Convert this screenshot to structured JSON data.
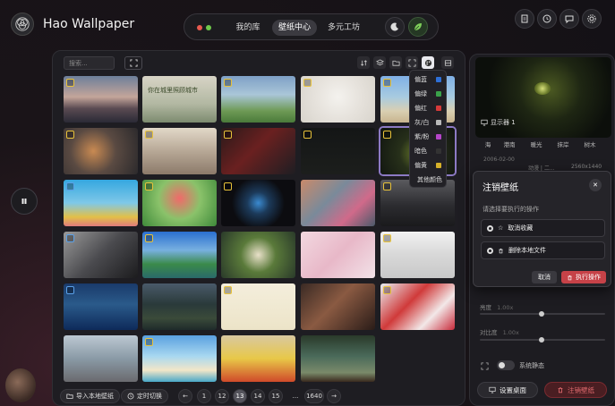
{
  "app": {
    "title": "Hao Wallpaper"
  },
  "nav": {
    "tabs": [
      {
        "label": "我的库",
        "active": false
      },
      {
        "label": "壁纸中心",
        "active": true
      },
      {
        "label": "多元工坊",
        "active": false
      }
    ],
    "dot_colors": [
      "#e85a4f",
      "#6fc94b"
    ]
  },
  "header_icons": [
    "moon-icon",
    "leaf-icon",
    "document-icon",
    "history-icon",
    "chat-icon",
    "settings-icon"
  ],
  "toolbar": {
    "search_placeholder": "搜索..."
  },
  "color_filter": {
    "items": [
      {
        "label": "偏蓝",
        "color": "#2e6fd6"
      },
      {
        "label": "偏绿",
        "color": "#3aa24a"
      },
      {
        "label": "偏红",
        "color": "#d63a3a"
      },
      {
        "label": "灰/白",
        "color": "#b9b9b9"
      },
      {
        "label": "紫/粉",
        "color": "#b545c9"
      },
      {
        "label": "暗色",
        "color": "#333333"
      },
      {
        "label": "偏黄",
        "color": "#d6b12a"
      },
      {
        "label": "其他颜色",
        "color": ""
      }
    ]
  },
  "grid": {
    "thumbs": [
      {
        "bg": "linear-gradient(180deg,#6d7f9a 0%,#c4a59a 45%,#5a4a52 70%,#2a2a36 100%)",
        "badge": "gold"
      },
      {
        "bg": "linear-gradient(180deg,#d8d4c6 0%,#b2b8a2 60%,#7d8b6f 100%)",
        "badge": "none"
      },
      {
        "bg": "linear-gradient(180deg,#7ea0c6 0%,#aac6d8 40%,#6e9a55 75%,#4a7a3a 100%)",
        "badge": "gold"
      },
      {
        "bg": "radial-gradient(circle at 50% 45%,#f4f2ee 0%,#e6e2dc 50%,#d8d4cc 100%)",
        "badge": "gold"
      },
      {
        "bg": "linear-gradient(180deg,#7fb0e6 0%,#a8cbe0 45%,#d9cfb2 75%,#c8b48e 100%)",
        "badge": "gold"
      },
      {
        "bg": "radial-gradient(circle at 40% 50%,#c98a52 0%,#5a4a42 45%,#2c2a2c 100%)",
        "badge": "gold"
      },
      {
        "bg": "linear-gradient(180deg,#e2d8c8 0%,#b7a896 50%,#8c7a6a 100%)",
        "badge": "gold"
      },
      {
        "bg": "linear-gradient(135deg,#2a1a1a 0%,#6a2020 45%,#1e1e22 100%)",
        "badge": "gold"
      },
      {
        "bg": "linear-gradient(180deg,#141616 0%,#1c1e1c 100%)",
        "badge": "gold"
      },
      {
        "bg": "radial-gradient(circle at 50% 55%,#6b7d2a 0%,#27301a 40%,#101410 100%)",
        "badge": "gold",
        "selected": true
      },
      {
        "bg": "linear-gradient(180deg,#35a7e0 0%,#7fc8e8 50%,#e2c048 80%,#e07b7b 100%)",
        "badge": "blue"
      },
      {
        "bg": "radial-gradient(circle at 50% 40%,#f06a6a 0%,#8ac26a 45%,#3f8a3a 100%)",
        "badge": "gold"
      },
      {
        "bg": "radial-gradient(circle at 50% 50%,#3a8ad0 0%,#1c3a5a 25%,#0c0c10 60%)",
        "badge": "gold"
      },
      {
        "bg": "linear-gradient(135deg,#c98a6a 0%,#7a8a9a 40%,#d06a8a 70%,#4a5a6a 100%)",
        "badge": "none"
      },
      {
        "bg": "linear-gradient(180deg,#5a5a5e 0%,#2c2c30 55%,#1a1a1c 100%)",
        "badge": "gold"
      },
      {
        "bg": "linear-gradient(135deg,#9a9a9a 0%,#4a4a4e 50%,#1c1c1e 100%)",
        "badge": "blue"
      },
      {
        "bg": "linear-gradient(180deg,#2a6fd0 0%,#78b0e0 40%,#3a8a4a 70%,#2a6a6a 100%)",
        "badge": "gold"
      },
      {
        "bg": "radial-gradient(circle at 50% 50%,#e8e0c8 0%,#5a7a3a 40%,#2a3a2a 100%)",
        "badge": "none"
      },
      {
        "bg": "linear-gradient(135deg,#f2d8e0 0%,#e8b8c8 50%,#f2e2e8 100%)",
        "badge": "none"
      },
      {
        "bg": "linear-gradient(180deg,#f2f2f2 0%,#d8d8d8 50%,#c8c8c8 100%)",
        "badge": "gold"
      },
      {
        "bg": "linear-gradient(180deg,#1a3a6a 0%,#2a5a8a 45%,#0e2a5a 100%)",
        "badge": "blue"
      },
      {
        "bg": "linear-gradient(180deg,#4a5a6a 0%,#2a3a3a 45%,#3a4a3a 75%,#1e2a2a 100%)",
        "badge": "none"
      },
      {
        "bg": "linear-gradient(180deg,#f4eedc 0%,#ece4c8 100%)",
        "badge": "gold"
      },
      {
        "bg": "linear-gradient(135deg,#3a2a24 0%,#8a5a42 45%,#2a1c18 100%)",
        "badge": "none"
      },
      {
        "bg": "linear-gradient(135deg,#e8eef2 0%,#d03a3a 40%,#f2e8e8 70%,#c82a3a 100%)",
        "badge": "gold"
      },
      {
        "bg": "linear-gradient(180deg,#bcc8d2 0%,#8a9aa6 50%,#6a6a6e 100%)",
        "badge": "none"
      },
      {
        "bg": "linear-gradient(180deg,#5aa0e0 0%,#a8d8f0 45%,#f2e6c8 75%,#48a8c8 100%)",
        "badge": "gold"
      },
      {
        "bg": "linear-gradient(180deg,#d8c8a0 0%,#e8c848 50%,#d04a2a 100%)",
        "badge": "none"
      },
      {
        "bg": "linear-gradient(180deg,#2a3a2a 0%,#4a6a5a 45%,#7a8a6a 80%,#3a2a1e 100%)",
        "badge": "none"
      }
    ],
    "overlay_texts": [
      "你在城里照顾城市"
    ]
  },
  "footer": {
    "import_label": "导入本地壁纸",
    "timer_label": "定时切换",
    "pages": [
      "1",
      "12",
      "13",
      "14",
      "15",
      "...",
      "1640"
    ],
    "current_page": "13"
  },
  "right_panel": {
    "monitor_label": "显示器 1",
    "tags": [
      "海",
      "港南",
      "暖光",
      "抹岸",
      "树木"
    ],
    "meta_date": "2006-02-00",
    "meta_mode": "动漫 | 二...",
    "meta_res": "2560x1440",
    "brightness_label": "亮度",
    "brightness_value": "1.00x",
    "contrast_label": "对比度",
    "contrast_value": "1.00x",
    "static_label": "系统静态",
    "set_desktop_label": "设置桌面",
    "unset_label": "注销壁纸"
  },
  "modal": {
    "title": "注销壁纸",
    "subtitle": "请选择要执行的操作",
    "option1": "取消收藏",
    "option2": "删除本地文件",
    "cancel": "取消",
    "confirm": "执行操作"
  }
}
